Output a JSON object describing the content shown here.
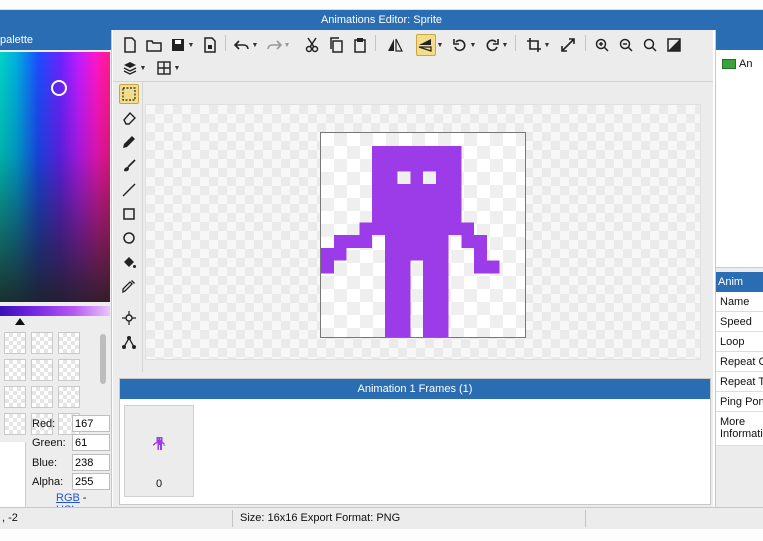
{
  "window": {
    "title": "Animations Editor: Sprite"
  },
  "palette": {
    "header": "palette",
    "color": {
      "red_label": "Red:",
      "red": "167",
      "green_label": "Green:",
      "green": "61",
      "blue_label": "Blue:",
      "blue": "238",
      "alpha_label": "Alpha:",
      "alpha": "255"
    },
    "mode_rgb": "RGB",
    "mode_sep": "-",
    "mode_hsl": "HSL"
  },
  "toolbar": {
    "icons": [
      "new-file-icon",
      "open-folder-icon",
      "save-icon",
      "save-dropdown",
      "export-icon",
      "undo-icon",
      "undo-dropdown",
      "redo-icon",
      "redo-dropdown",
      "cut-icon",
      "copy-icon",
      "paste-icon",
      "flip-horizontal-icon",
      "flip-vertical-icon",
      "rotate-left-icon",
      "rotate-right-icon",
      "crop-icon",
      "resize-icon",
      "zoom-in-icon",
      "zoom-out-icon",
      "zoom-fit-icon",
      "toggle-bg-icon",
      "layers-icon",
      "grid-icon"
    ]
  },
  "tools": [
    "select-tool",
    "eraser-tool",
    "pencil-tool",
    "brush-tool",
    "line-tool",
    "rectangle-tool",
    "ellipse-tool",
    "fill-tool",
    "eyedropper-tool",
    "origin-tool",
    "bone-tool"
  ],
  "sprite": {
    "color": "#9b3ce8",
    "grid": 16,
    "pixels": [
      "................",
      "....#######.....",
      "....#######.....",
      "....##.#.##.....",
      "....#######.....",
      "....#######.....",
      "....#######.....",
      "...#########....",
      ".###.#####.##...",
      "##...#####..#...",
      "#....##.##..##..",
      ".....##.##......",
      ".....##.##......",
      ".....##.##......",
      ".....##.##......",
      ".....##.##......"
    ]
  },
  "frames": {
    "header": "Animation 1 Frames (1)",
    "items": [
      {
        "index": "0"
      }
    ]
  },
  "layers": {
    "items": [
      {
        "label": "An"
      }
    ]
  },
  "properties": {
    "header": "Anim",
    "rows": [
      "Name",
      "Speed",
      "Loop",
      "Repeat C",
      "Repeat T",
      "Ping Pon",
      "More Informati"
    ]
  },
  "status": {
    "coord": ", -2",
    "size": "Size: 16x16  Export Format: PNG"
  },
  "colors": {
    "accent": "#2a6db3",
    "sprite": "#9b3ce8",
    "highlight": "#f3dc8a"
  }
}
